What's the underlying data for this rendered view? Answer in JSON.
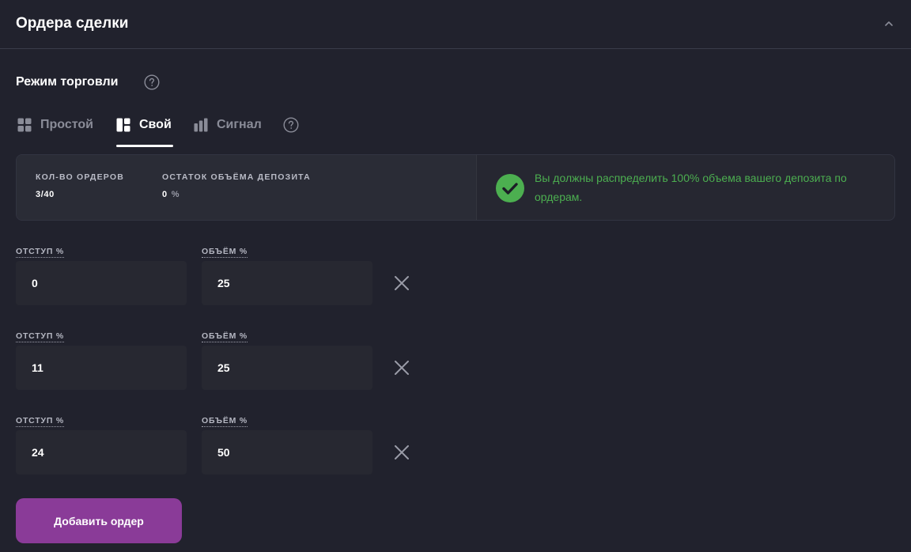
{
  "header": {
    "title": "Ордера сделки"
  },
  "mode_section": {
    "title": "Режим торговли"
  },
  "tabs": [
    {
      "label": "Простой",
      "icon": "grid-icon",
      "active": false
    },
    {
      "label": "Свой",
      "icon": "layout-icon",
      "active": true
    },
    {
      "label": "Сигнал",
      "icon": "bar-chart-icon",
      "active": false
    }
  ],
  "stats": {
    "orders_label": "КОЛ-ВО ОРДЕРОВ",
    "orders_value": "3/40",
    "remaining_label": "ОСТАТОК ОБЪЁМА ДЕПОЗИТА",
    "remaining_value": "0",
    "remaining_unit": "%"
  },
  "notice": {
    "text": "Вы должны распределить 100% объема вашего депозита по ордерам.",
    "color": "#4caf50"
  },
  "orders": [
    {
      "offset_label": "ОТСТУП %",
      "offset_value": "0",
      "volume_label": "ОБЪЁМ %",
      "volume_value": "25"
    },
    {
      "offset_label": "ОТСТУП %",
      "offset_value": "11",
      "volume_label": "ОБЪЁМ %",
      "volume_value": "25"
    },
    {
      "offset_label": "ОТСТУП %",
      "offset_value": "24",
      "volume_label": "ОБЪЁМ %",
      "volume_value": "50"
    }
  ],
  "add_button": {
    "label": "Добавить ордер",
    "color": "#8a3b98"
  }
}
